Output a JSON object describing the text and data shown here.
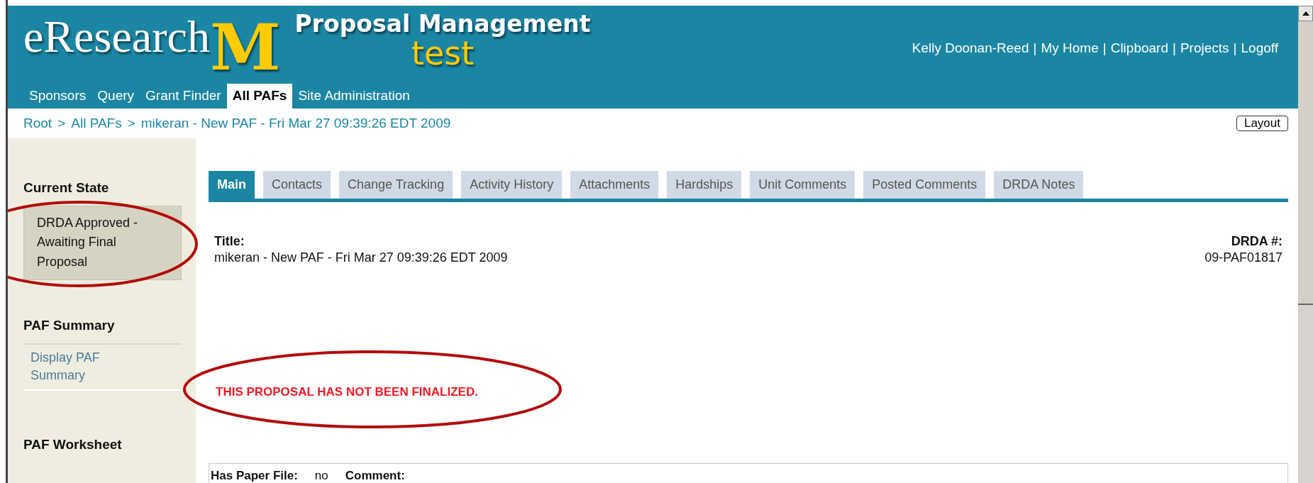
{
  "header": {
    "brand": "eResearch",
    "logo_mark": "M",
    "app_title": "Proposal Management",
    "environment": "test",
    "user_links": [
      "Kelly Doonan-Reed",
      "My Home",
      "Clipboard",
      "Projects",
      "Logoff"
    ],
    "separator": "|"
  },
  "nav": [
    {
      "label": "Sponsors",
      "selected": false
    },
    {
      "label": "Query",
      "selected": false
    },
    {
      "label": "Grant Finder",
      "selected": false
    },
    {
      "label": "All PAFs",
      "selected": true
    },
    {
      "label": "Site Administration",
      "selected": false
    }
  ],
  "breadcrumb": {
    "items": [
      "Root",
      "All PAFs",
      "mikeran - New PAF - Fri Mar 27 09:39:26 EDT 2009"
    ],
    "separator": ">"
  },
  "layout_button": "Layout",
  "sidebar": {
    "sections": [
      {
        "heading": "Current State",
        "kind": "state",
        "text": "DRDA Approved - Awaiting Final Proposal"
      },
      {
        "heading": "PAF Summary",
        "kind": "links",
        "links": [
          "Display PAF Summary"
        ]
      },
      {
        "heading": "PAF Worksheet",
        "kind": "links"
      }
    ]
  },
  "tabs": [
    {
      "label": "Main",
      "selected": true
    },
    {
      "label": "Contacts",
      "selected": false
    },
    {
      "label": "Change Tracking",
      "selected": false
    },
    {
      "label": "Activity History",
      "selected": false
    },
    {
      "label": "Attachments",
      "selected": false
    },
    {
      "label": "Hardships",
      "selected": false
    },
    {
      "label": "Unit Comments",
      "selected": false
    },
    {
      "label": "Posted Comments",
      "selected": false
    },
    {
      "label": "DRDA Notes",
      "selected": false
    }
  ],
  "main": {
    "title_label": "Title:",
    "title_value": "mikeran - New PAF - Fri Mar 27 09:39:26 EDT 2009",
    "drda_label": "DRDA #:",
    "drda_value": "09-PAF01817",
    "warning": "THIS PROPOSAL HAS NOT BEEN FINALIZED.",
    "details": [
      {
        "label": "Has Paper File:",
        "value": "no"
      },
      {
        "label": "Comment:"
      }
    ]
  }
}
